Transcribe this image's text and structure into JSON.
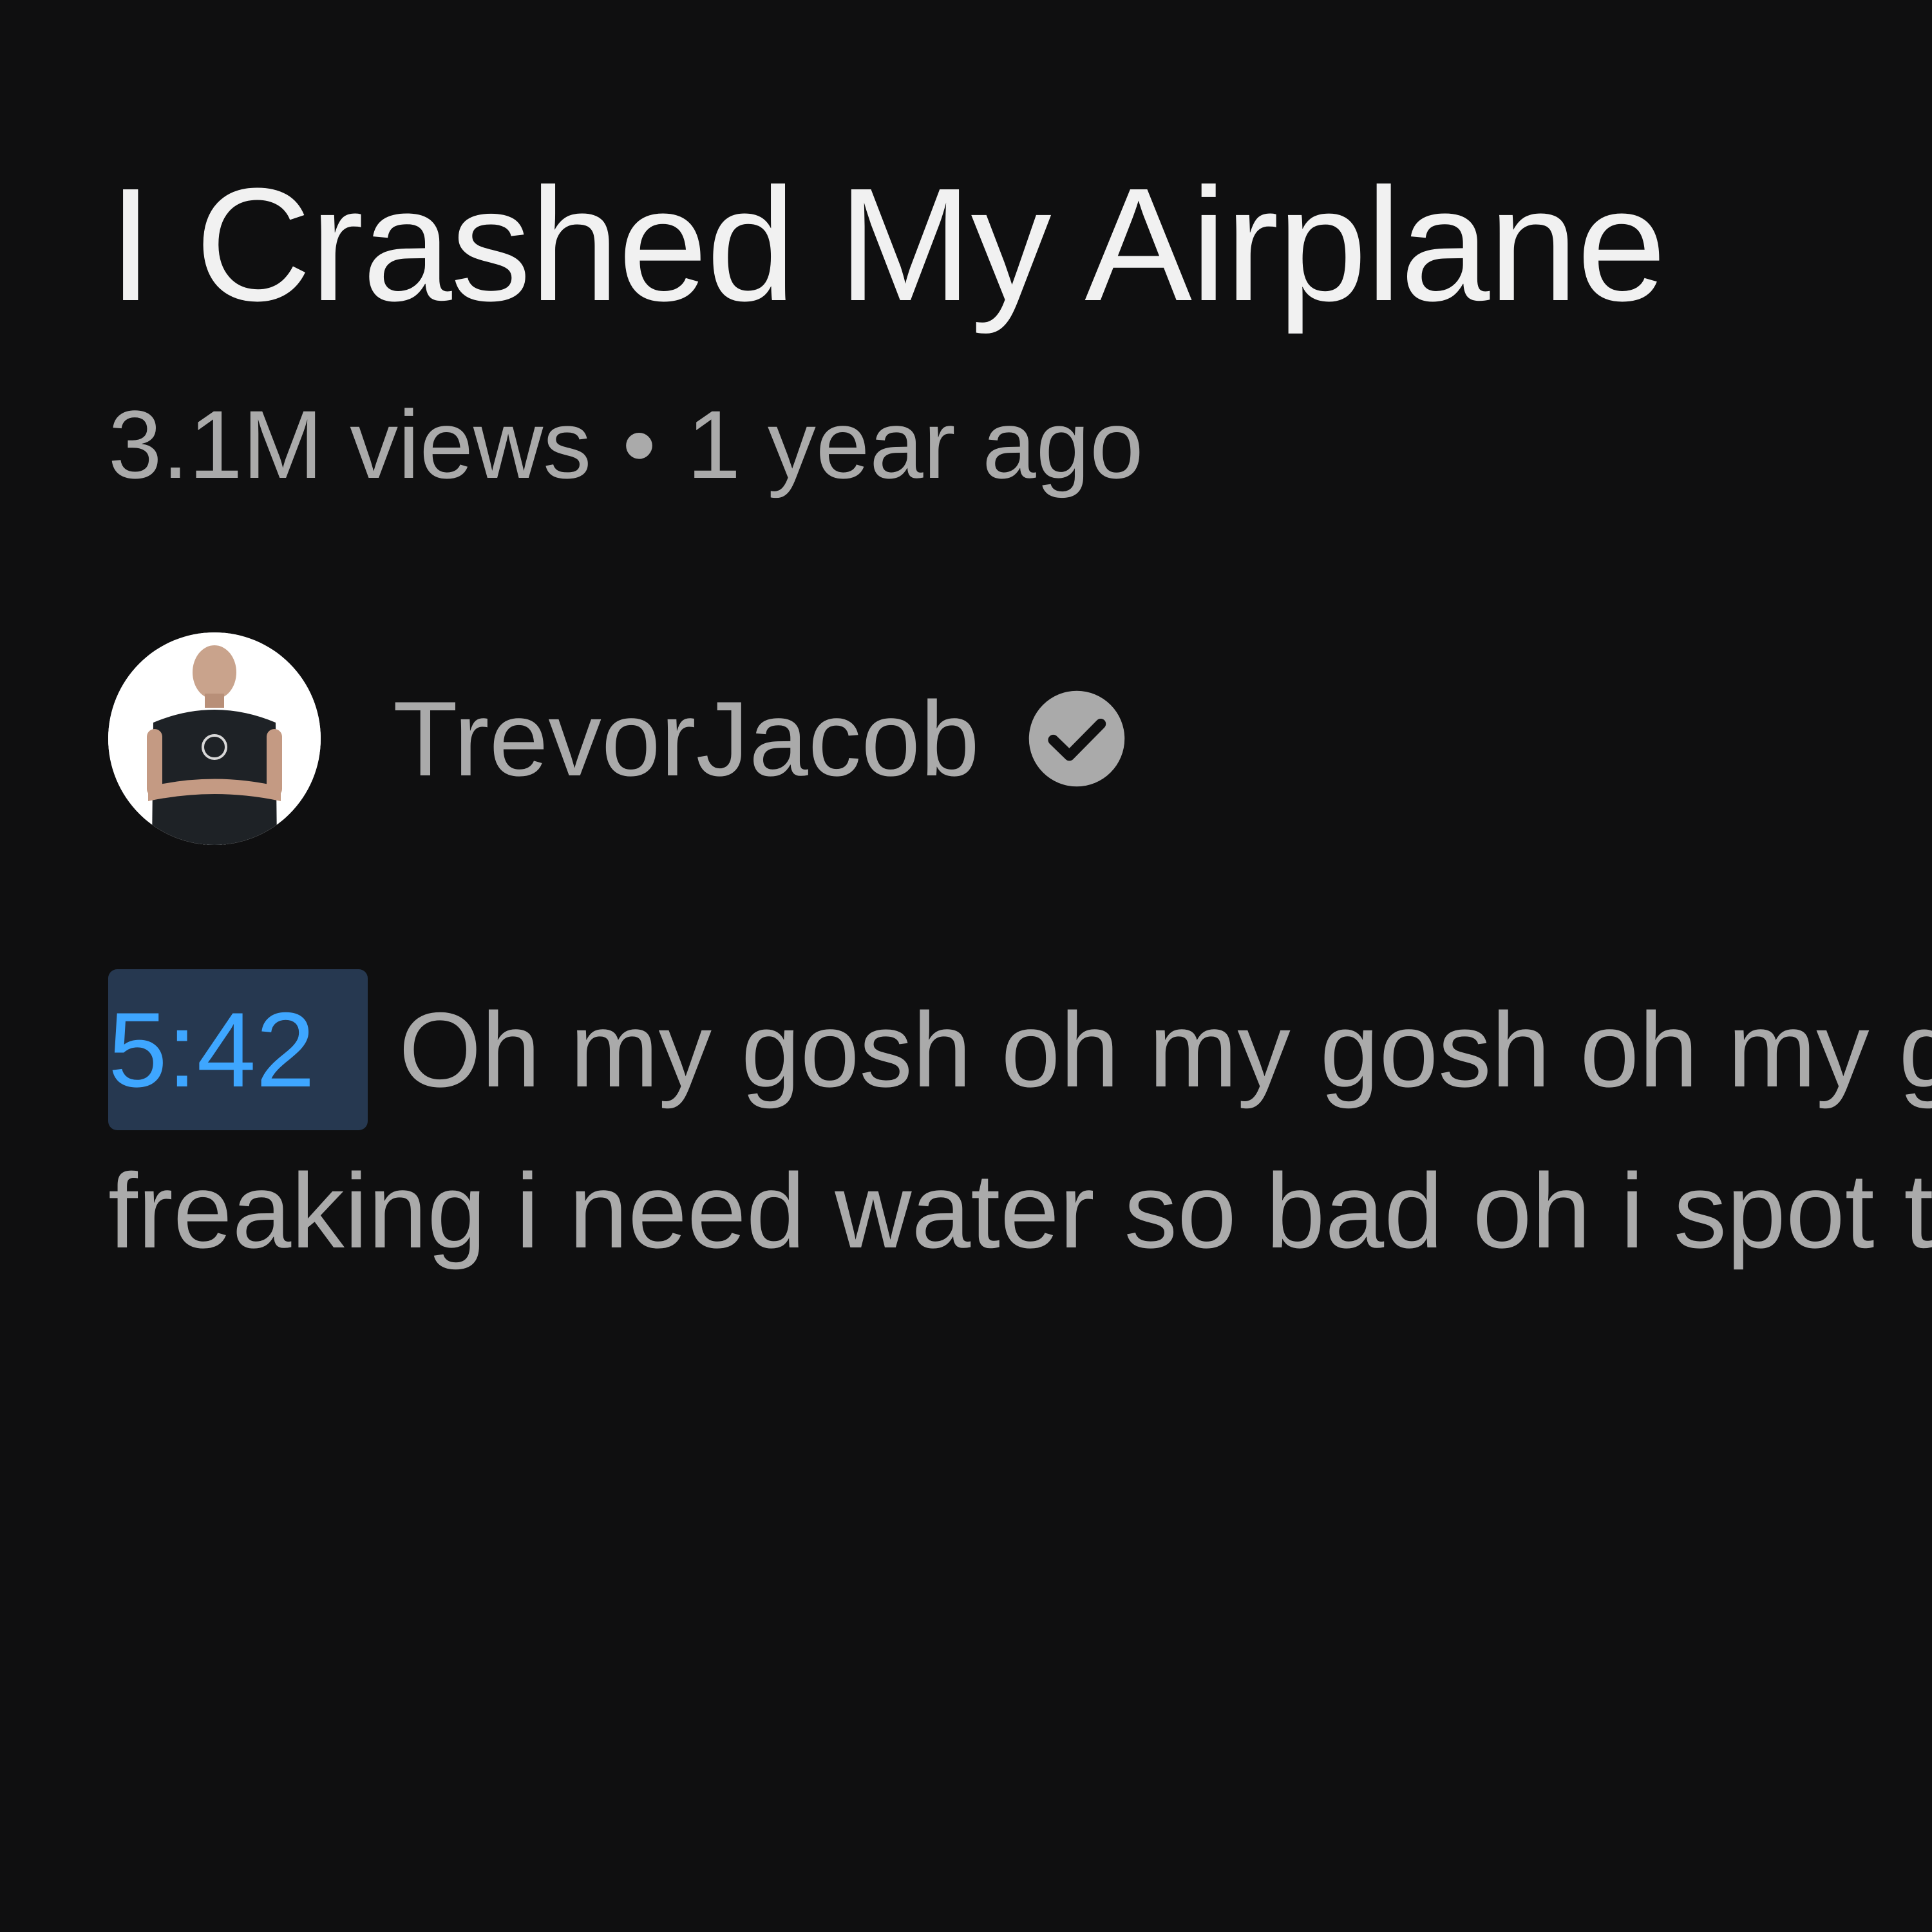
{
  "video": {
    "title": "I Crashed My Airplane",
    "views": "3.1M views",
    "separator": "•",
    "age": "1 year ago"
  },
  "channel": {
    "name": "TrevorJacob",
    "verified_icon": "verified-check-icon",
    "avatar": "channel-avatar"
  },
  "snippet": {
    "timestamp": "5:42",
    "line1": "Oh my gosh oh my gosh oh my g",
    "line2": "freaking i need water so bad oh i spot t"
  },
  "colors": {
    "background": "#0f0f10",
    "title": "#f1f1f1",
    "secondary_text": "#aaaaaa",
    "timestamp_text": "#3ea6ff",
    "timestamp_bg": "#263850"
  }
}
